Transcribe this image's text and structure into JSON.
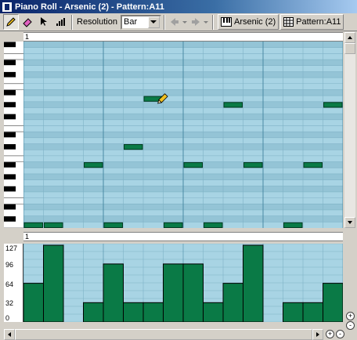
{
  "window": {
    "title": "Piano Roll - Arsenic (2) - Pattern:A11"
  },
  "toolbar": {
    "resolution_label": "Resolution",
    "resolution_value": "Bar",
    "track_button": "Arsenic (2)",
    "pattern_button": "Pattern:A11"
  },
  "ruler": {
    "top_marker": "1",
    "bottom_marker": "1"
  },
  "velocity_scale": {
    "labels": [
      "127",
      "96",
      "64",
      "32",
      "0"
    ]
  },
  "notes": [
    {
      "step": 0,
      "length": 1,
      "row": 30
    },
    {
      "step": 1,
      "length": 1,
      "row": 30
    },
    {
      "step": 3,
      "length": 1,
      "row": 20
    },
    {
      "step": 4,
      "length": 1,
      "row": 30
    },
    {
      "step": 5,
      "length": 1,
      "row": 17
    },
    {
      "step": 6,
      "length": 1,
      "row": 9
    },
    {
      "step": 7,
      "length": 1,
      "row": 30
    },
    {
      "step": 8,
      "length": 1,
      "row": 20
    },
    {
      "step": 9,
      "length": 1,
      "row": 30
    },
    {
      "step": 10,
      "length": 1,
      "row": 10
    },
    {
      "step": 11,
      "length": 1,
      "row": 20
    },
    {
      "step": 13,
      "length": 1,
      "row": 30
    },
    {
      "step": 14,
      "length": 1,
      "row": 20
    },
    {
      "step": 15,
      "length": 1,
      "row": 10
    }
  ],
  "velocities": [
    64,
    127,
    0,
    32,
    96,
    32,
    32,
    96,
    96,
    32,
    64,
    127,
    0,
    32,
    32,
    64
  ],
  "colors": {
    "grid_background": "#a8d4e4",
    "note_fill": "#0a7a46",
    "velocity_bar": "#0a7a46"
  }
}
